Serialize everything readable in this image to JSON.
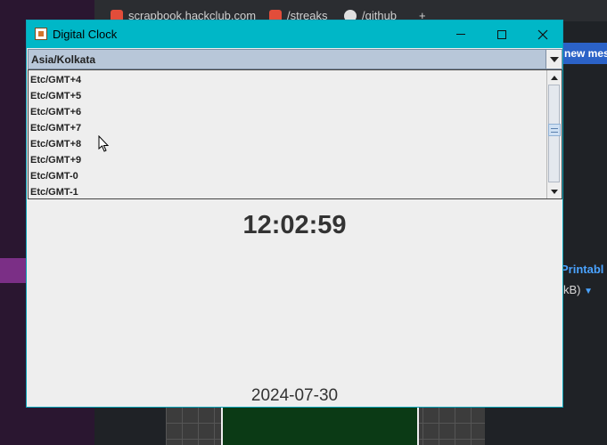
{
  "background": {
    "tabs": [
      {
        "label": "scrapbook.hackclub.com"
      },
      {
        "label": "/streaks"
      },
      {
        "label": "/github"
      },
      {
        "label": "+"
      }
    ],
    "right_panel_text": "new mes",
    "right_link": "Printabl",
    "right_size": "kB)"
  },
  "window": {
    "title": "Digital Clock",
    "icon": "java-cup-icon",
    "controls": [
      "minimize-icon",
      "maximize-icon",
      "close-icon"
    ]
  },
  "timezone": {
    "selected": "Asia/Kolkata",
    "visible_options": [
      "Etc/GMT+4",
      "Etc/GMT+5",
      "Etc/GMT+6",
      "Etc/GMT+7",
      "Etc/GMT+8",
      "Etc/GMT+9",
      "Etc/GMT-0",
      "Etc/GMT-1"
    ]
  },
  "clock": {
    "time": "12:02:59",
    "date": "2024-07-30"
  },
  "colors": {
    "titlebar": "#00b7c7",
    "combo_bg": "#b8c7d9",
    "window_bg": "#eeeeee",
    "text": "#333333"
  }
}
